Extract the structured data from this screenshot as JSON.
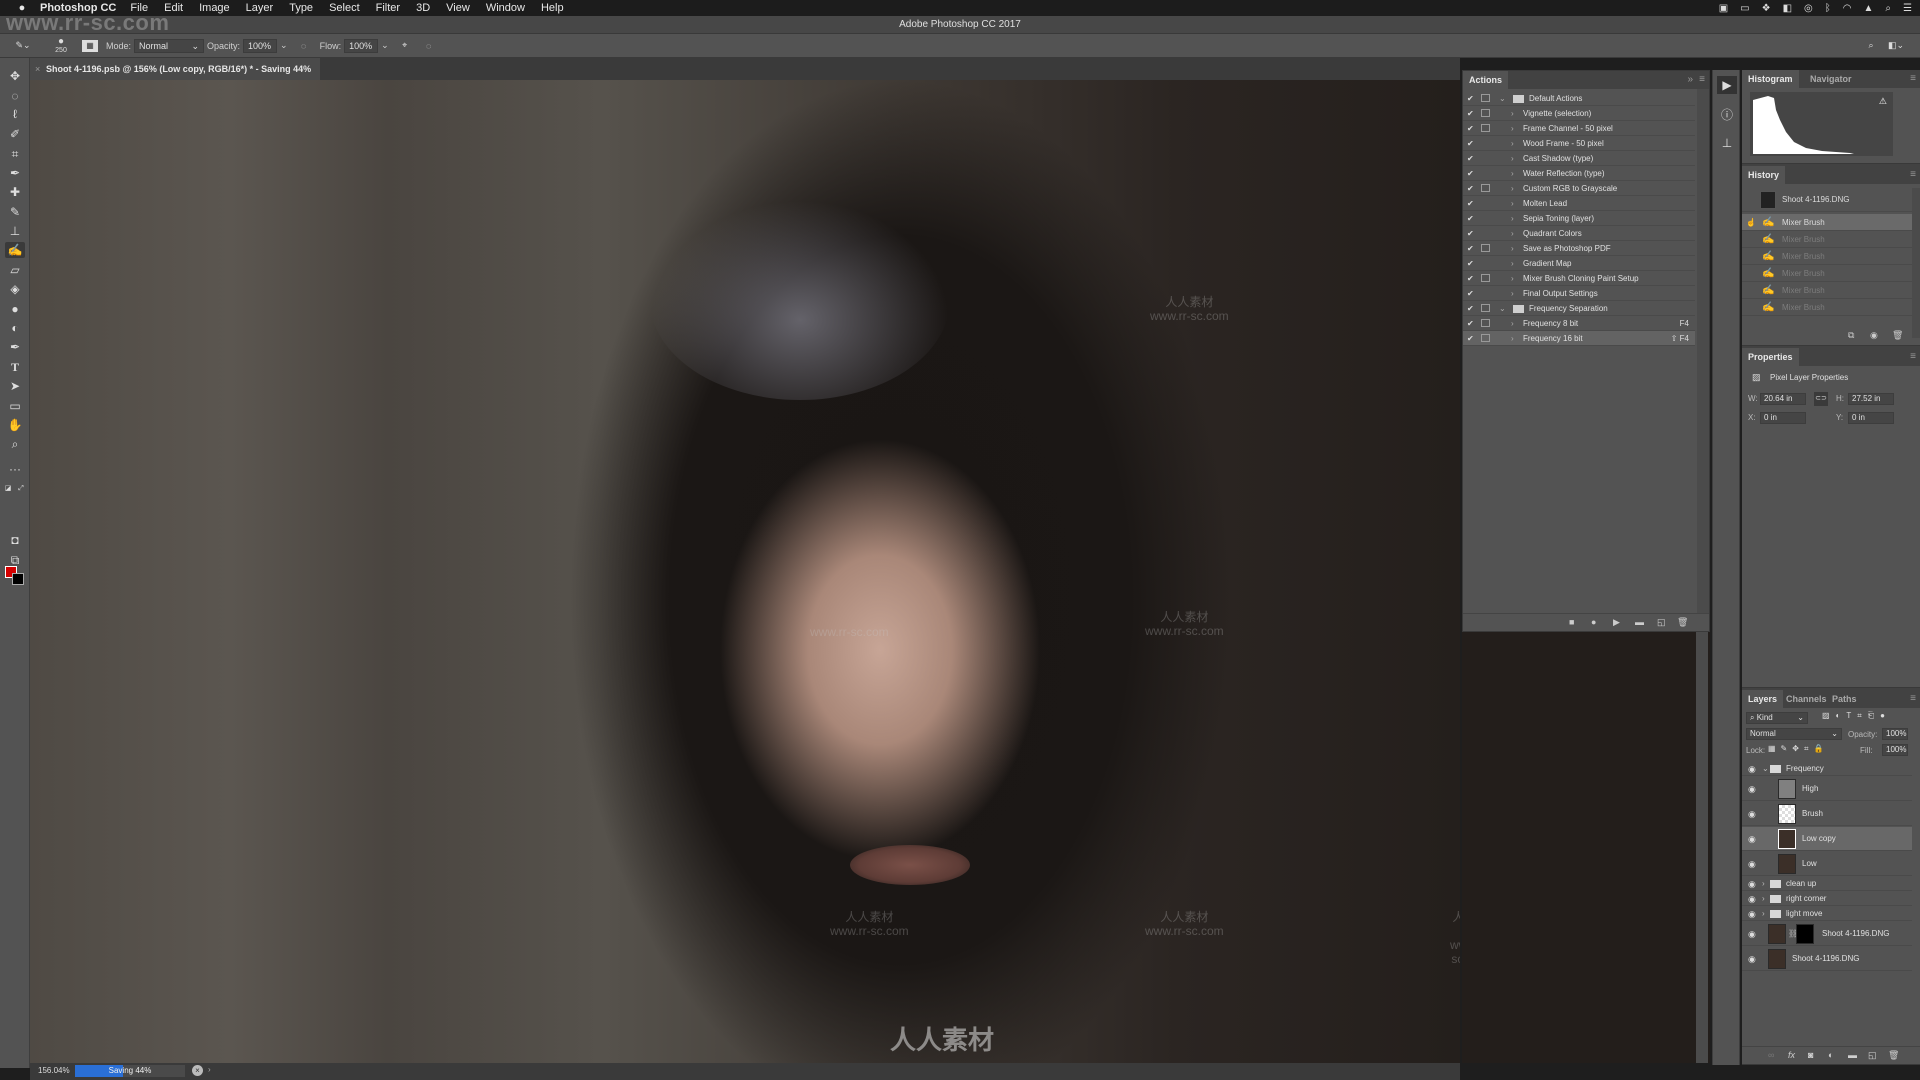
{
  "menubar": {
    "app_name": "Photoshop CC",
    "items": [
      "File",
      "Edit",
      "Image",
      "Layer",
      "Type",
      "Select",
      "Filter",
      "3D",
      "View",
      "Window",
      "Help"
    ],
    "tray_icons": [
      "screen-record-icon",
      "battery-icon",
      "dropbox-icon",
      "display-icon",
      "creative-cloud-icon",
      "bluetooth-icon",
      "wifi-icon",
      "airplay-icon",
      "spotlight-search-icon",
      "notification-center-icon"
    ]
  },
  "window": {
    "title": "Adobe Photoshop CC 2017"
  },
  "watermark": {
    "url": "www.rr-sc.com",
    "logo_text": "人人素材"
  },
  "options_bar": {
    "brush_size": "250",
    "mode_label": "Mode:",
    "mode_value": "Normal",
    "opacity_label": "Opacity:",
    "opacity_value": "100%",
    "flow_label": "Flow:",
    "flow_value": "100%"
  },
  "document": {
    "tab_title": "Shoot 4-1196.psb @ 156% (Low copy, RGB/16*) * - Saving 44%"
  },
  "status": {
    "zoom": "156.04%",
    "saving_label": "Saving 44%",
    "saving_progress": 0.44
  },
  "toolbar": {
    "tools": [
      "move",
      "marquee",
      "lasso",
      "quick-selection",
      "crop",
      "eyedropper",
      "healing-brush",
      "brush",
      "clone-stamp",
      "mixer-brush",
      "eraser",
      "paint-bucket",
      "blur",
      "dodge",
      "pen",
      "type",
      "path-selection",
      "rectangle",
      "hand",
      "zoom",
      "more"
    ],
    "active_tool": "mixer-brush",
    "foreground_color": "#d40000",
    "background_color": "#000000"
  },
  "actions_panel": {
    "tab": "Actions",
    "rows": [
      {
        "name": "Default Actions",
        "level": 0,
        "folder": true,
        "expanded": true,
        "dialog": true
      },
      {
        "name": "Vignette (selection)",
        "level": 1,
        "dialog": true
      },
      {
        "name": "Frame Channel - 50 pixel",
        "level": 1,
        "dialog": true
      },
      {
        "name": "Wood Frame - 50 pixel",
        "level": 1,
        "dialog": false
      },
      {
        "name": "Cast Shadow (type)",
        "level": 1,
        "dialog": false
      },
      {
        "name": "Water Reflection (type)",
        "level": 1,
        "dialog": false
      },
      {
        "name": "Custom RGB to Grayscale",
        "level": 1,
        "dialog": true
      },
      {
        "name": "Molten Lead",
        "level": 1,
        "dialog": false
      },
      {
        "name": "Sepia Toning (layer)",
        "level": 1,
        "dialog": false
      },
      {
        "name": "Quadrant Colors",
        "level": 1,
        "dialog": false
      },
      {
        "name": "Save as Photoshop PDF",
        "level": 1,
        "dialog": true
      },
      {
        "name": "Gradient Map",
        "level": 1,
        "dialog": false
      },
      {
        "name": "Mixer Brush Cloning Paint Setup",
        "level": 1,
        "dialog": true
      },
      {
        "name": "Final Output Settings",
        "level": 1,
        "dialog": false
      },
      {
        "name": "Frequency Separation",
        "level": 0,
        "folder": true,
        "expanded": true,
        "dialog": true
      },
      {
        "name": "Frequency 8 bit",
        "level": 1,
        "dialog": true,
        "key": "F4"
      },
      {
        "name": "Frequency 16 bit",
        "level": 1,
        "dialog": true,
        "key": "⇧ F4",
        "selected": true
      }
    ],
    "footer_icons": [
      "stop-icon",
      "record-icon",
      "play-icon",
      "new-set-icon",
      "new-action-icon",
      "delete-icon"
    ]
  },
  "histogram_panel": {
    "tabs": [
      "Histogram",
      "Navigator"
    ],
    "active_tab": "Histogram"
  },
  "history_panel": {
    "tab": "History",
    "snapshot": "Shoot 4-1196.DNG",
    "states": [
      {
        "name": "Mixer Brush",
        "active": true
      },
      {
        "name": "Mixer Brush",
        "active": false
      },
      {
        "name": "Mixer Brush",
        "active": false
      },
      {
        "name": "Mixer Brush",
        "active": false
      },
      {
        "name": "Mixer Brush",
        "active": false
      },
      {
        "name": "Mixer Brush",
        "active": false
      }
    ]
  },
  "properties_panel": {
    "tab": "Properties",
    "title": "Pixel Layer Properties",
    "w_label": "W:",
    "w_value": "20.64 in",
    "h_label": "H:",
    "h_value": "27.52 in",
    "x_label": "X:",
    "x_value": "0 in",
    "y_label": "Y:",
    "y_value": "0 in"
  },
  "layers_panel": {
    "tabs": [
      "Layers",
      "Channels",
      "Paths"
    ],
    "active_tab": "Layers",
    "filter_kind": "Kind",
    "blend_mode": "Normal",
    "opacity_label": "Opacity:",
    "opacity_value": "100%",
    "lock_label": "Lock:",
    "fill_label": "Fill:",
    "fill_value": "100%",
    "layers": [
      {
        "name": "Frequency",
        "type": "group",
        "expanded": true,
        "visible": true
      },
      {
        "name": "High",
        "type": "pixel",
        "indent": true,
        "visible": true,
        "thumb": "gray"
      },
      {
        "name": "Brush",
        "type": "pixel",
        "indent": true,
        "visible": true,
        "thumb": "transparent"
      },
      {
        "name": "Low copy",
        "type": "pixel",
        "indent": true,
        "visible": true,
        "thumb": "photo",
        "selected": true
      },
      {
        "name": "Low",
        "type": "pixel",
        "indent": true,
        "visible": true,
        "thumb": "photo"
      },
      {
        "name": "clean up",
        "type": "group",
        "expanded": false,
        "visible": true
      },
      {
        "name": "right corner",
        "type": "group",
        "expanded": false,
        "visible": true
      },
      {
        "name": "light move",
        "type": "group",
        "expanded": false,
        "visible": true
      },
      {
        "name": "Shoot 4-1196.DNG",
        "type": "masked",
        "visible": true,
        "thumb": "photo"
      },
      {
        "name": "Shoot 4-1196.DNG",
        "type": "pixel",
        "visible": true,
        "thumb": "photo"
      }
    ],
    "footer_icons": [
      "link-icon",
      "fx-icon",
      "mask-icon",
      "adjustment-icon",
      "group-icon",
      "new-layer-icon",
      "delete-icon"
    ]
  }
}
